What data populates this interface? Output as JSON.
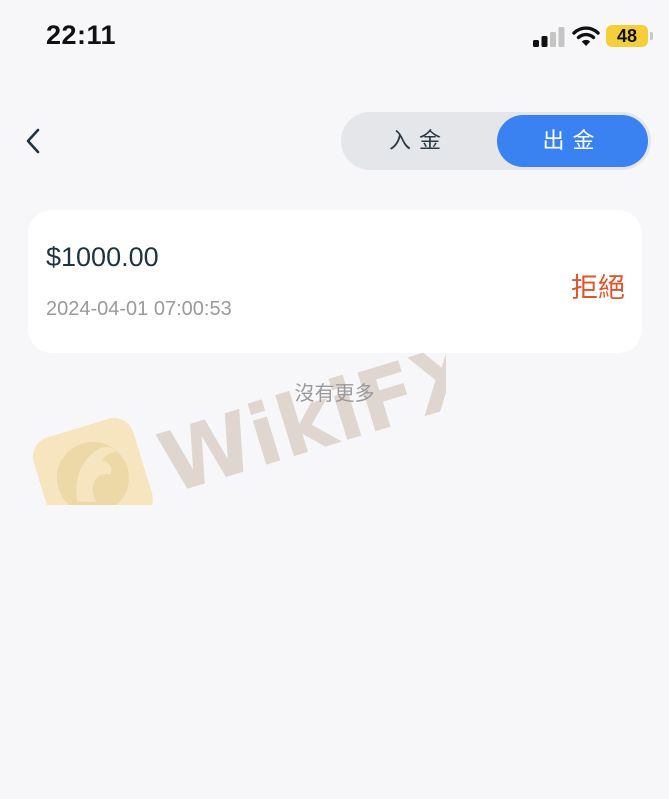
{
  "status_bar": {
    "time": "22:11",
    "battery_level": "48",
    "icons": [
      "signal-icon",
      "wifi-icon",
      "battery-icon"
    ]
  },
  "header": {
    "back_icon": "chevron-left-icon",
    "tabs": [
      {
        "label": "入金",
        "selected": false
      },
      {
        "label": "出金",
        "selected": true
      }
    ]
  },
  "records": [
    {
      "amount": "$1000.00",
      "time": "2024-04-01 07:00:53",
      "status": "拒絕"
    }
  ],
  "footer": {
    "no_more": "沒有更多"
  },
  "watermark": {
    "text": "WikiFX",
    "icon": "eagle-logo-icon"
  },
  "colors": {
    "accent": "#3a82f2",
    "rejected": "#e0532b",
    "background": "#f7f7f9",
    "watermark_logo": "#f3d9a0",
    "watermark_text": "#d9cdc5"
  }
}
